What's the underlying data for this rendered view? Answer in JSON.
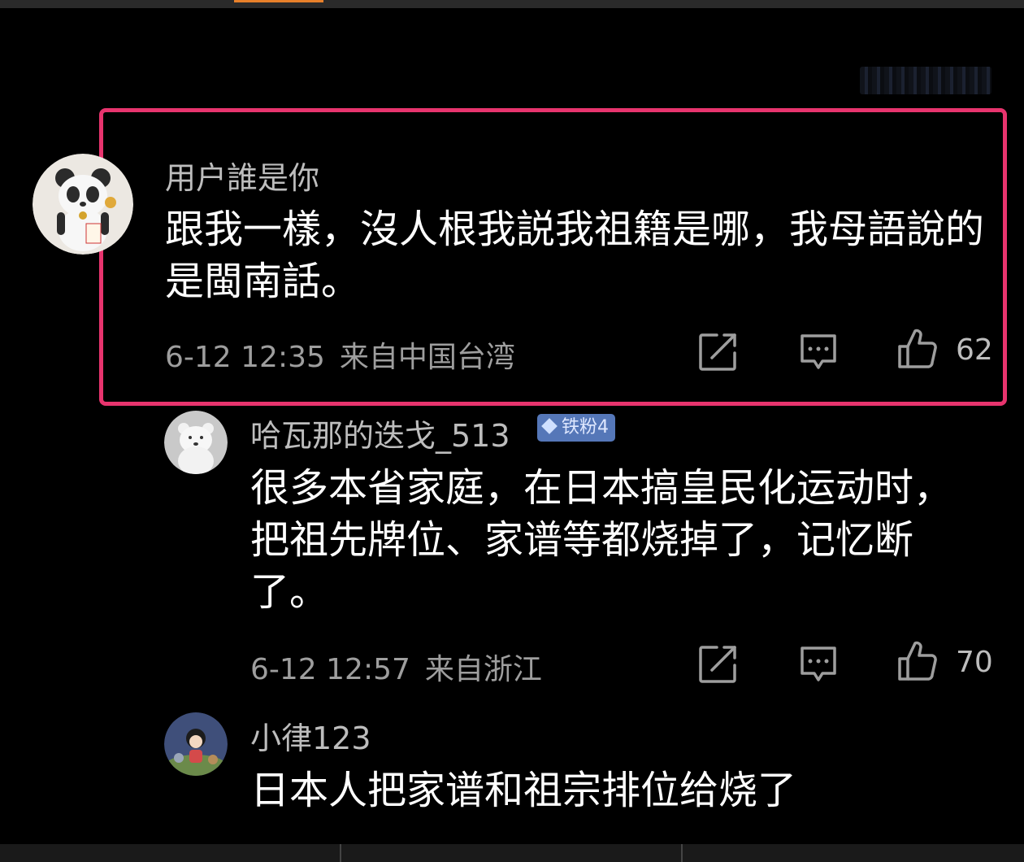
{
  "comments": [
    {
      "username": "用户誰是你",
      "content": "跟我一樣，沒人根我説我祖籍是哪，我母語說的是閩南話。",
      "time": "6-12 12:35",
      "location": "来自中国台湾",
      "likes": "62"
    },
    {
      "username": "哈瓦那的迭戈_513",
      "badge": "铁粉4",
      "content": "很多本省家庭，在日本搞皇民化运动时，把祖先牌位、家谱等都烧掉了，记忆断了。",
      "time": "6-12 12:57",
      "location": "来自浙江",
      "likes": "70"
    },
    {
      "username": "小律123",
      "content": "日本人把家谱和祖宗排位给烧了"
    }
  ],
  "icons": {
    "share": "share-icon",
    "reply": "comment-icon",
    "like": "thumbs-up-icon"
  },
  "colors": {
    "background": "#000000",
    "highlight": "#e8346e",
    "badge": "#5577b8",
    "username": "#bdbdbd",
    "meta": "#9e9e9e"
  }
}
